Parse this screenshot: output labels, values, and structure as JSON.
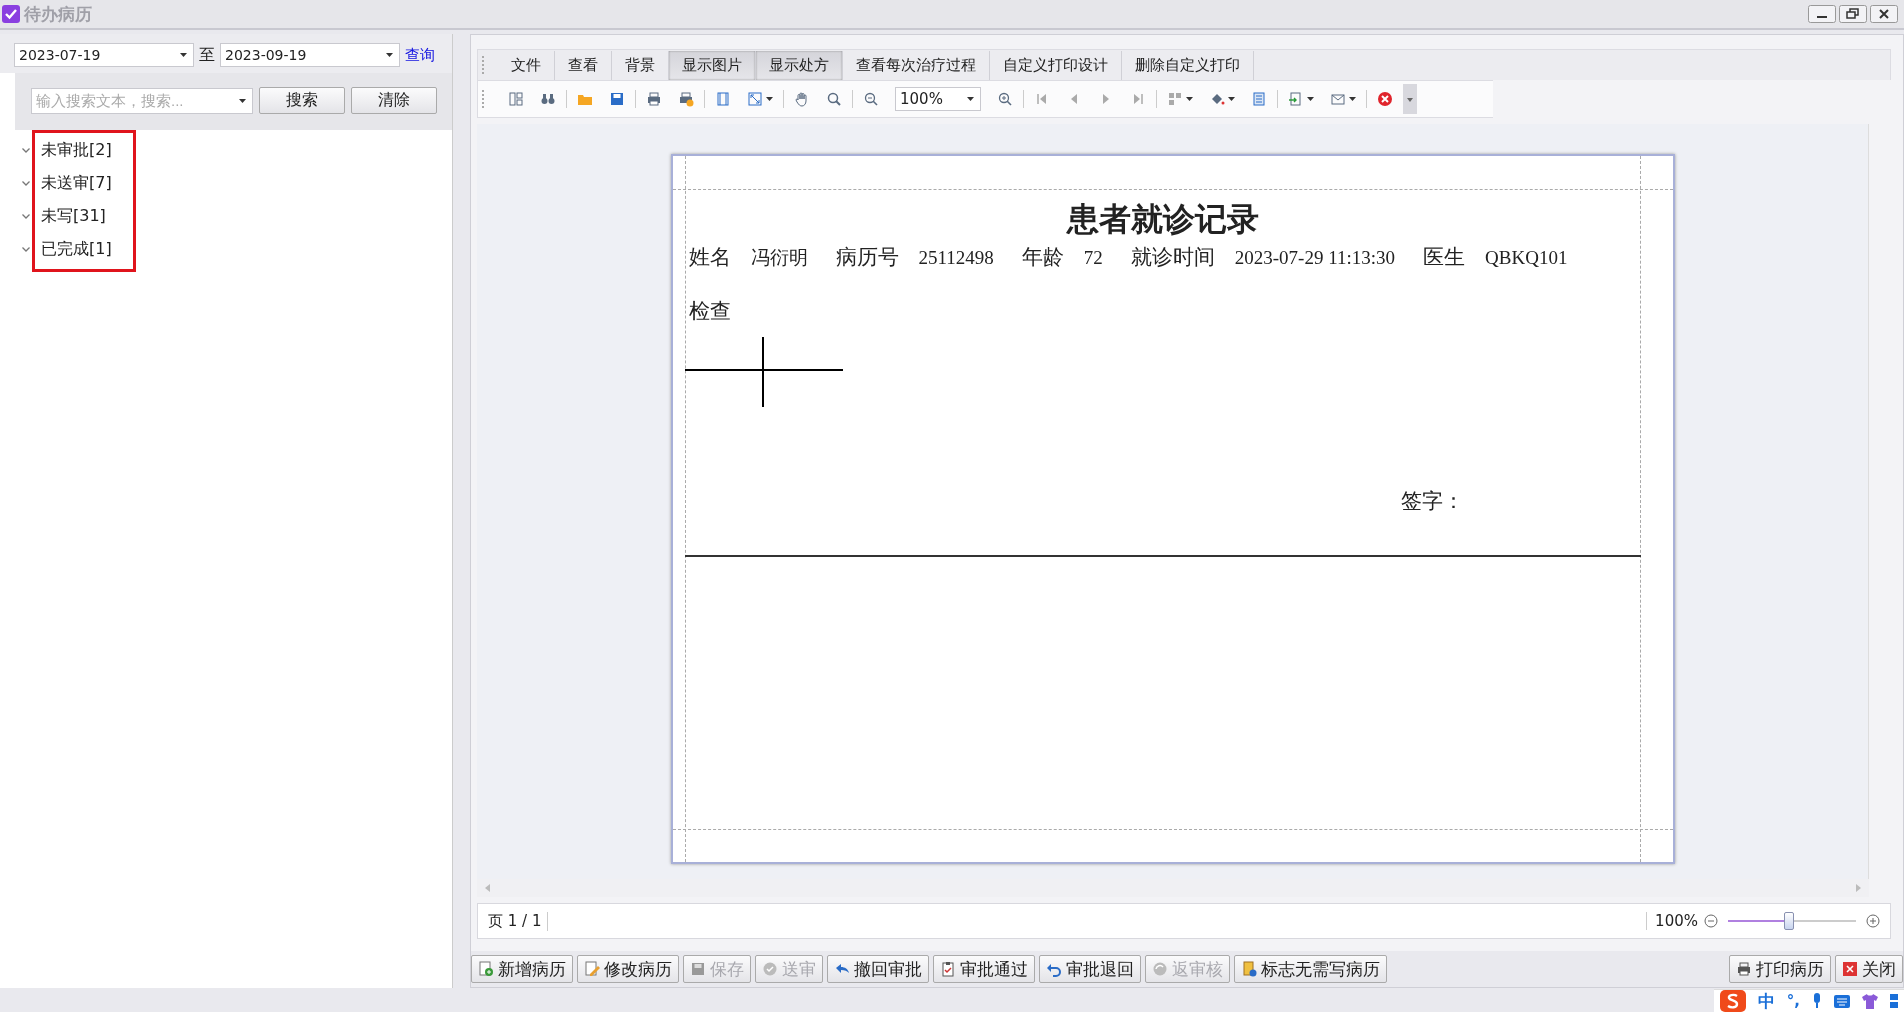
{
  "window": {
    "title": "待办病历"
  },
  "filter": {
    "date_from": "2023-07-19",
    "separator": "至",
    "date_to": "2023-09-19",
    "query_link": "查询"
  },
  "search": {
    "placeholder": "输入搜索文本，搜索...",
    "buttons": [
      "搜索",
      "清除"
    ]
  },
  "tree": {
    "items": [
      {
        "label": "未审批[2]"
      },
      {
        "label": "未送审[7]"
      },
      {
        "label": "未写[31]"
      },
      {
        "label": "已完成[1]"
      }
    ]
  },
  "menu": [
    {
      "label": "文件",
      "pressed": false
    },
    {
      "label": "查看",
      "pressed": false
    },
    {
      "label": "背景",
      "pressed": false
    },
    {
      "label": "显示图片",
      "pressed": true
    },
    {
      "label": "显示处方",
      "pressed": true
    },
    {
      "label": "查看每次治疗过程",
      "pressed": false
    },
    {
      "label": "自定义打印设计",
      "pressed": false
    },
    {
      "label": "删除自定义打印",
      "pressed": false
    }
  ],
  "toolbar": {
    "zoom_value": "100%"
  },
  "report": {
    "title": "患者就诊记录",
    "fields": [
      {
        "label": "姓名",
        "value": "冯衍明"
      },
      {
        "label": "病历号",
        "value": "25112498"
      },
      {
        "label": "年龄",
        "value": "72"
      },
      {
        "label": "就诊时间",
        "value": "2023-07-29 11:13:30"
      },
      {
        "label": "医生",
        "value": "QBKQ101"
      }
    ],
    "section": "检查",
    "signature": "签字："
  },
  "status_bar": {
    "page": "页 1 / 1",
    "zoom": "100%",
    "zoom_slider": {
      "level": 0.48
    }
  },
  "actions": [
    {
      "label": "新增病历",
      "kind": "add",
      "disabled": false
    },
    {
      "label": "修改病历",
      "kind": "edit",
      "disabled": false
    },
    {
      "label": "保存",
      "kind": "save",
      "disabled": true
    },
    {
      "label": "送审",
      "kind": "send",
      "disabled": true
    },
    {
      "label": "撤回审批",
      "kind": "undo",
      "disabled": false
    },
    {
      "label": "审批通过",
      "kind": "approve",
      "disabled": false
    },
    {
      "label": "审批退回",
      "kind": "return",
      "disabled": false
    },
    {
      "label": "返审核",
      "kind": "recheck",
      "disabled": true
    },
    {
      "label": "标志无需写病历",
      "kind": "mark",
      "disabled": false
    }
  ],
  "right_actions": [
    {
      "label": "打印病历",
      "kind": "print",
      "disabled": false
    },
    {
      "label": "关闭",
      "kind": "close",
      "disabled": false
    }
  ],
  "ime_bar": {
    "mode": "中",
    "punctuation": "°,"
  }
}
